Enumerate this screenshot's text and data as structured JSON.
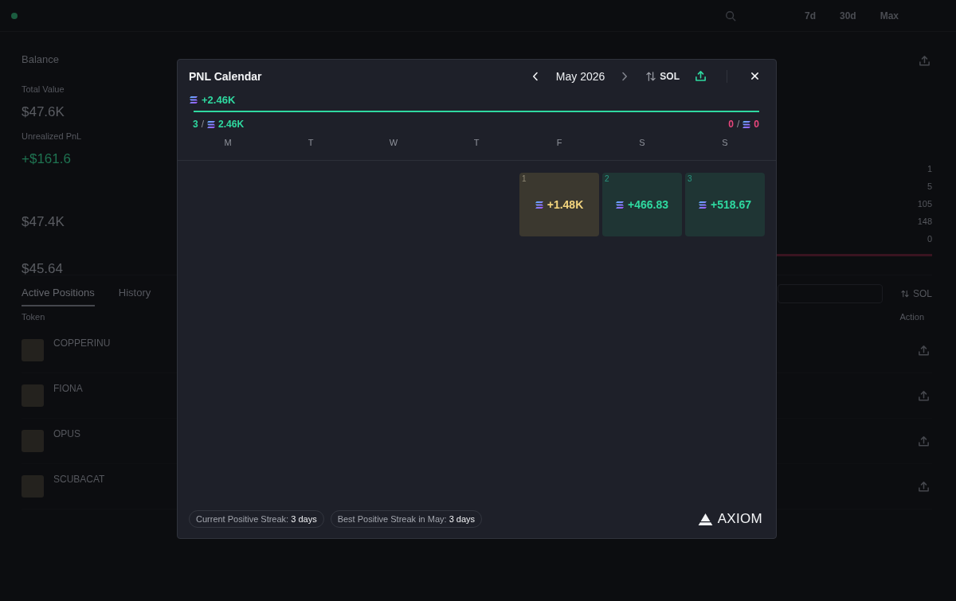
{
  "background": {
    "period_labels": [
      "7d",
      "30d",
      "Max"
    ],
    "balance": {
      "title": "Balance",
      "stats": [
        {
          "label": "Total Value",
          "value": "$47.6K",
          "kind": "plain"
        },
        {
          "label": "Unrealized PnL",
          "value": "+$161.6",
          "kind": "gain"
        },
        {
          "value": "$47.4K",
          "kind": "plain"
        },
        {
          "value": "$45.64",
          "kind": "plain"
        }
      ]
    },
    "side_values": [
      "1",
      "5",
      "105",
      "148",
      "0"
    ],
    "positions": {
      "tabs": [
        {
          "label": "Active Positions",
          "selected": true
        },
        {
          "label": "History",
          "selected": false
        }
      ],
      "currency": "SOL",
      "column_1": "Token",
      "column_last": "Action",
      "rows": [
        {
          "name": "COPPERINU"
        },
        {
          "name": "FIONA"
        },
        {
          "name": "OPUS"
        },
        {
          "name": "SCUBACAT"
        }
      ]
    }
  },
  "pnl_calendar": {
    "title": "PNL Calendar",
    "month": "May 2026",
    "prev": {
      "disabled": false
    },
    "next": {
      "disabled": true
    },
    "currency": "SOL",
    "total": "+2.46K",
    "level": 1,
    "positive": {
      "count": "3",
      "separator": "/",
      "amount": "2.46K"
    },
    "negative": {
      "count": "0",
      "separator": "/",
      "amount": "0"
    },
    "weekdays": [
      "M",
      "T",
      "W",
      "T",
      "F",
      "S",
      "S"
    ],
    "weeks": [
      [
        {
          "kind": "empty"
        },
        {
          "kind": "empty"
        },
        {
          "kind": "empty"
        },
        {
          "kind": "empty"
        },
        {
          "kind": "day",
          "day": "1",
          "pnl": "+1.48K",
          "best": true
        },
        {
          "kind": "day",
          "day": "2",
          "pnl": "+466.83",
          "best": false
        },
        {
          "kind": "day",
          "day": "3",
          "pnl": "+518.67",
          "best": false
        }
      ]
    ],
    "streaks": [
      {
        "label": "Current Positive Streak:",
        "value": "3 days"
      },
      {
        "label": "Best Positive Streak in May:",
        "value": "3 days"
      }
    ],
    "brand": "AXIOM"
  }
}
